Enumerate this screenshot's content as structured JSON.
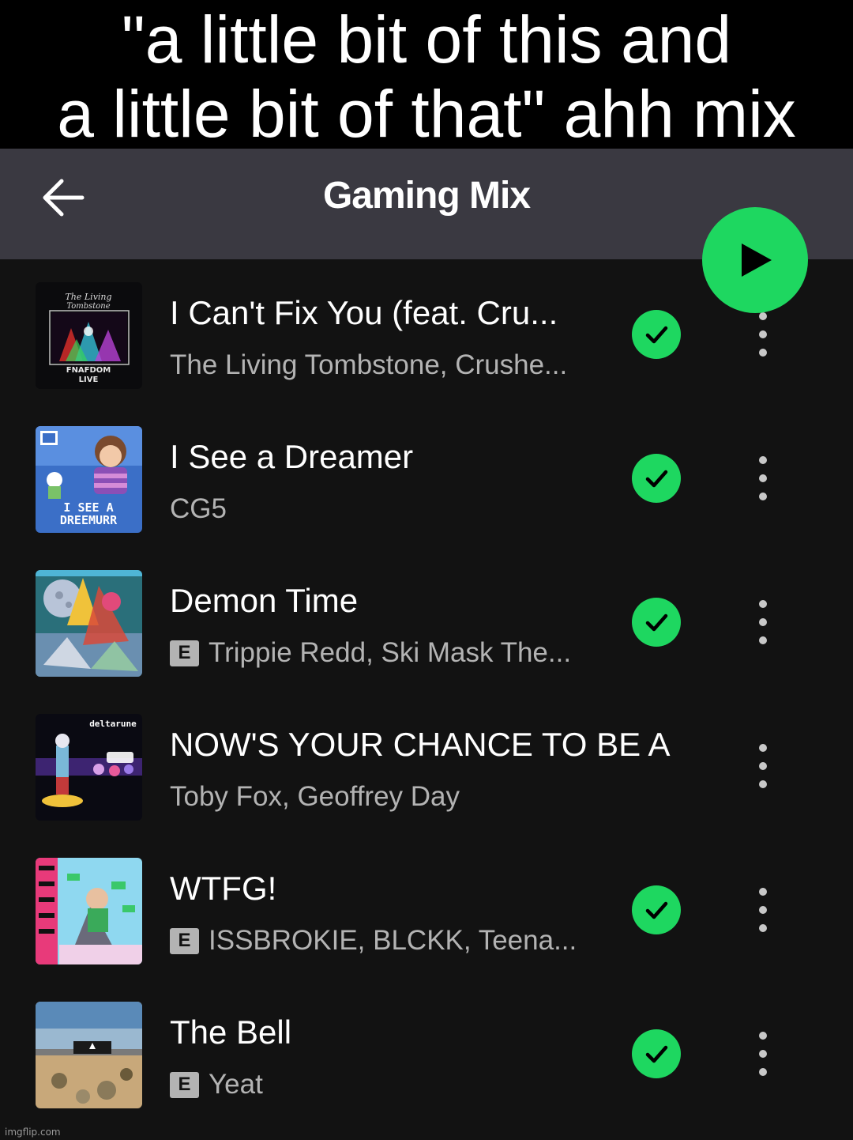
{
  "meme": {
    "caption_line1": "\"a little bit of this and",
    "caption_line2": "a little bit of that\" ahh mix"
  },
  "header": {
    "title": "Gaming Mix",
    "back_icon": "arrow-left-icon"
  },
  "play_button": {
    "icon": "play-icon"
  },
  "colors": {
    "accent_green": "#1ed760",
    "header_bg": "#3a3941",
    "list_bg": "#121212",
    "secondary_text": "#b3b3b3"
  },
  "tracks": [
    {
      "title": "I Can't Fix You (feat. Cru...",
      "artists": "The Living Tombstone, Crushe...",
      "explicit": false,
      "downloaded": true,
      "cover_text": [
        "FNAFDOM",
        "LIVE"
      ]
    },
    {
      "title": "I See a Dreamer",
      "artists": "CG5",
      "explicit": false,
      "downloaded": true,
      "cover_text": [
        "I SEE A",
        "DREEMURR"
      ]
    },
    {
      "title": "Demon Time",
      "artists": "Trippie Redd, Ski Mask The...",
      "explicit": true,
      "downloaded": true
    },
    {
      "title": "NOW'S YOUR CHANCE TO BE A",
      "artists": "Toby Fox, Geoffrey Day",
      "explicit": false,
      "downloaded": false,
      "cover_text": [
        "deltarune"
      ]
    },
    {
      "title": "WTFG!",
      "artists": "ISSBROKIE, BLCKK, Teena...",
      "explicit": true,
      "downloaded": true
    },
    {
      "title": "The Bell",
      "artists": "Yeat",
      "explicit": true,
      "downloaded": true
    }
  ],
  "explicit_label": "E",
  "watermark": "imgflip.com"
}
